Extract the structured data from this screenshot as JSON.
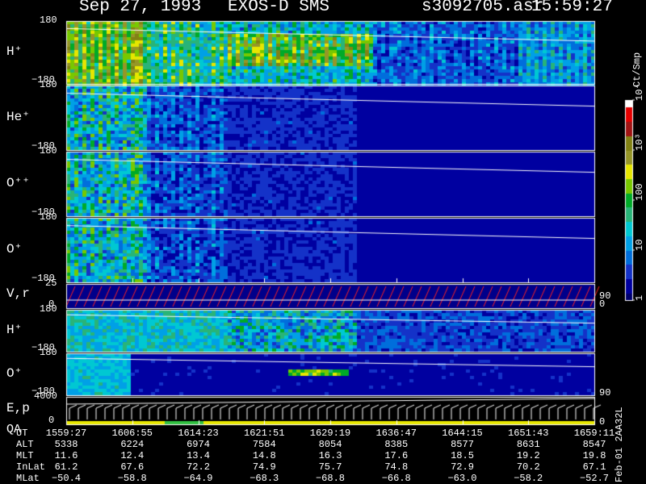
{
  "header": {
    "date": "Sep 27, 1993",
    "instrument": "EXOS-D SMS",
    "file": "s3092705.asr",
    "time": "15:59:27"
  },
  "colorbar": {
    "unit_label": "Ct/Smp",
    "tick_labels": [
      "1",
      "10",
      "100",
      "10³",
      "10⁴"
    ]
  },
  "side_note": "Feb-01 2AA32L",
  "chart_data": {
    "type": "heatmap",
    "x_axis": "UT",
    "color_scale": "log",
    "colorbar_range": [
      1,
      10000
    ],
    "panels": [
      {
        "label": "H⁺",
        "y_range": [
          -180,
          180
        ],
        "ticks": [
          "180",
          "−180"
        ]
      },
      {
        "label": "He⁺",
        "y_range": [
          -180,
          180
        ],
        "ticks": [
          "180",
          "−180"
        ]
      },
      {
        "label": "O⁺⁺",
        "y_range": [
          -180,
          180
        ],
        "ticks": [
          "180",
          "−180"
        ]
      },
      {
        "label": "O⁺",
        "y_range": [
          -180,
          180
        ],
        "ticks": [
          "180",
          "−180"
        ]
      },
      {
        "label": "V,r",
        "y_range": [
          0,
          25
        ],
        "ticks": [
          "25",
          "0"
        ],
        "right_ticks": [
          "90",
          "0"
        ]
      },
      {
        "label": "H⁺",
        "y_range": [
          -180,
          180
        ],
        "ticks": [
          "180",
          "−180"
        ]
      },
      {
        "label": "O⁺",
        "y_range": [
          -180,
          180
        ],
        "ticks": [
          "180",
          "−180"
        ],
        "right_ticks": [
          "90"
        ]
      },
      {
        "label": "E,p",
        "sub_label": "QA",
        "y_range": [
          0,
          4000
        ],
        "ticks": [
          "4000",
          "0"
        ],
        "right_ticks": [
          "0"
        ]
      }
    ],
    "table": {
      "row_labels": [
        "UT",
        "ALT",
        "MLT",
        "InLat",
        "MLat"
      ],
      "columns": [
        [
          "1559:27",
          "5338",
          "11.6",
          "61.2",
          "−50.4"
        ],
        [
          "1606:55",
          "6224",
          "12.4",
          "67.6",
          "−58.8"
        ],
        [
          "1614:23",
          "6974",
          "13.4",
          "72.2",
          "−64.9"
        ],
        [
          "1621:51",
          "7584",
          "14.8",
          "74.9",
          "−68.3"
        ],
        [
          "1629:19",
          "8054",
          "16.3",
          "75.7",
          "−68.8"
        ],
        [
          "1636:47",
          "8385",
          "17.6",
          "74.8",
          "−66.8"
        ],
        [
          "1644:15",
          "8577",
          "18.5",
          "72.9",
          "−63.0"
        ],
        [
          "1651:43",
          "8631",
          "19.2",
          "70.2",
          "−58.2"
        ],
        [
          "1659:11",
          "8547",
          "19.8",
          "67.1",
          "−52.7"
        ]
      ]
    }
  }
}
